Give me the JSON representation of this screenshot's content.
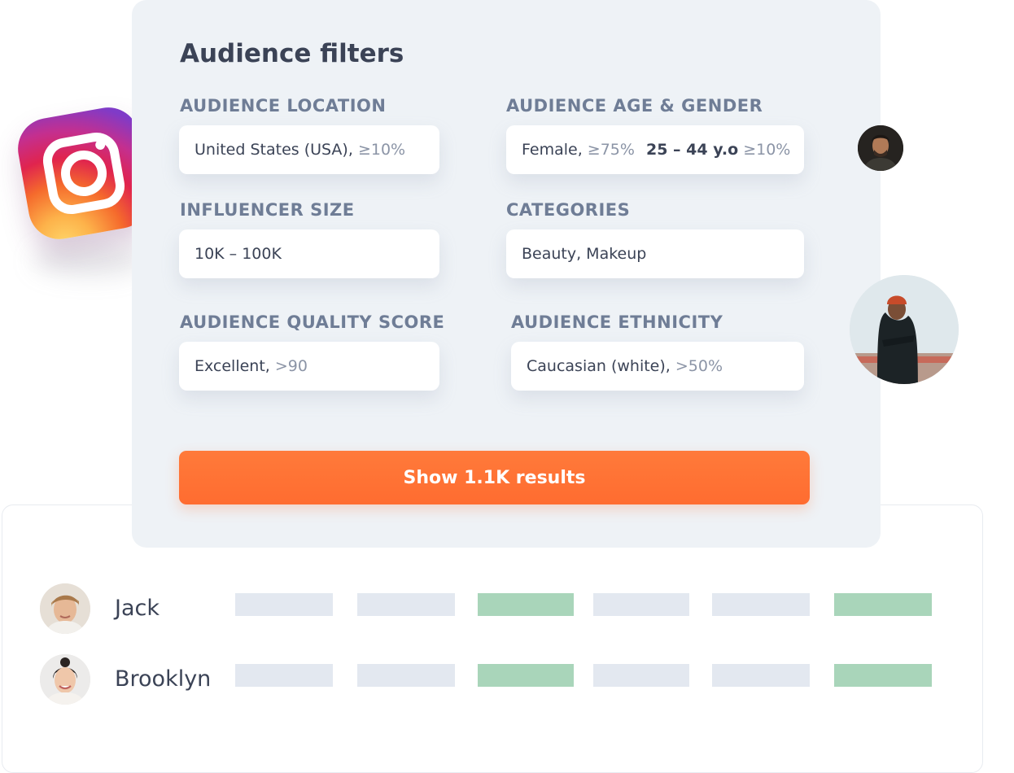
{
  "filters": {
    "title": "Audience filters",
    "audience_location": {
      "label": "AUDIENCE LOCATION",
      "value": "United States (USA),",
      "threshold": "≥10%"
    },
    "audience_age_gender": {
      "label": "AUDIENCE AGE & GENDER",
      "gender": "Female,",
      "gender_threshold": "≥75%",
      "age": "25 – 44 y.o",
      "age_threshold": "≥10%"
    },
    "influencer_size": {
      "label": "INFLUENCER SIZE",
      "value": "10K – 100K"
    },
    "categories": {
      "label": "CATEGORIES",
      "value": "Beauty, Makeup"
    },
    "quality_score": {
      "label": "AUDIENCE QUALITY SCORE",
      "value": "Excellent,",
      "threshold": ">90"
    },
    "ethnicity": {
      "label": "AUDIENCE ETHNICITY",
      "value": "Caucasian (white),",
      "threshold": ">50%"
    },
    "show_results_label": "Show 1.1K results"
  },
  "results": {
    "rows": [
      {
        "name": "Jack",
        "bars": [
          "grey",
          "grey",
          "green",
          "grey",
          "grey",
          "green"
        ]
      },
      {
        "name": "Brooklyn",
        "bars": [
          "grey",
          "grey",
          "green",
          "grey",
          "grey",
          "green"
        ]
      }
    ]
  },
  "colors": {
    "accent": "#ff6c30",
    "panel_bg": "#eef2f6",
    "bar_grey": "#e3e8f0",
    "bar_green": "#a9d5ba"
  },
  "icons": {
    "brand_logo": "instagram-logo-icon"
  }
}
